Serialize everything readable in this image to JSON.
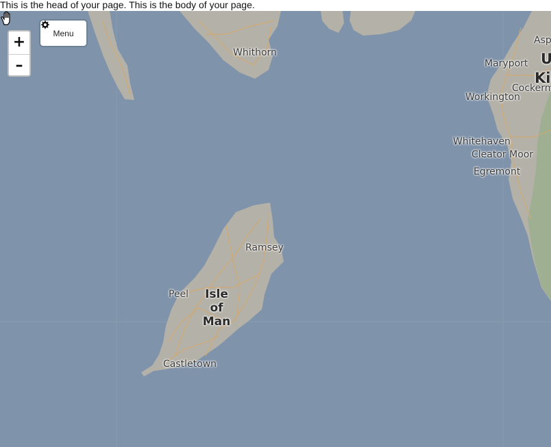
{
  "page": {
    "text": "This is the head of your page. This is the body of your page."
  },
  "controls": {
    "zoom_in": "+",
    "zoom_out": "–",
    "menu_label": "Menu",
    "menu_icon": "gear-icon"
  },
  "map": {
    "colors": {
      "sea": "#7f93aa",
      "land": "#b4b1a8",
      "land_green": "#9fb092",
      "roads": "#d5a86a"
    },
    "labels": {
      "whithorn": "Whithorn",
      "maryport": "Maryport",
      "workington": "Workington",
      "cockermouth": "Cockerm",
      "aspatria": "Asp",
      "uk_line1": "U",
      "uk_line2": "Ki",
      "whitehaven": "Whitehaven",
      "cleator_moor": "Cleator Moor",
      "egremont": "Egremont",
      "ramsey": "Ramsey",
      "peel": "Peel",
      "isle_line1": "Isle",
      "isle_line2": "of",
      "isle_line3": "Man",
      "castletown": "Castletown"
    }
  }
}
